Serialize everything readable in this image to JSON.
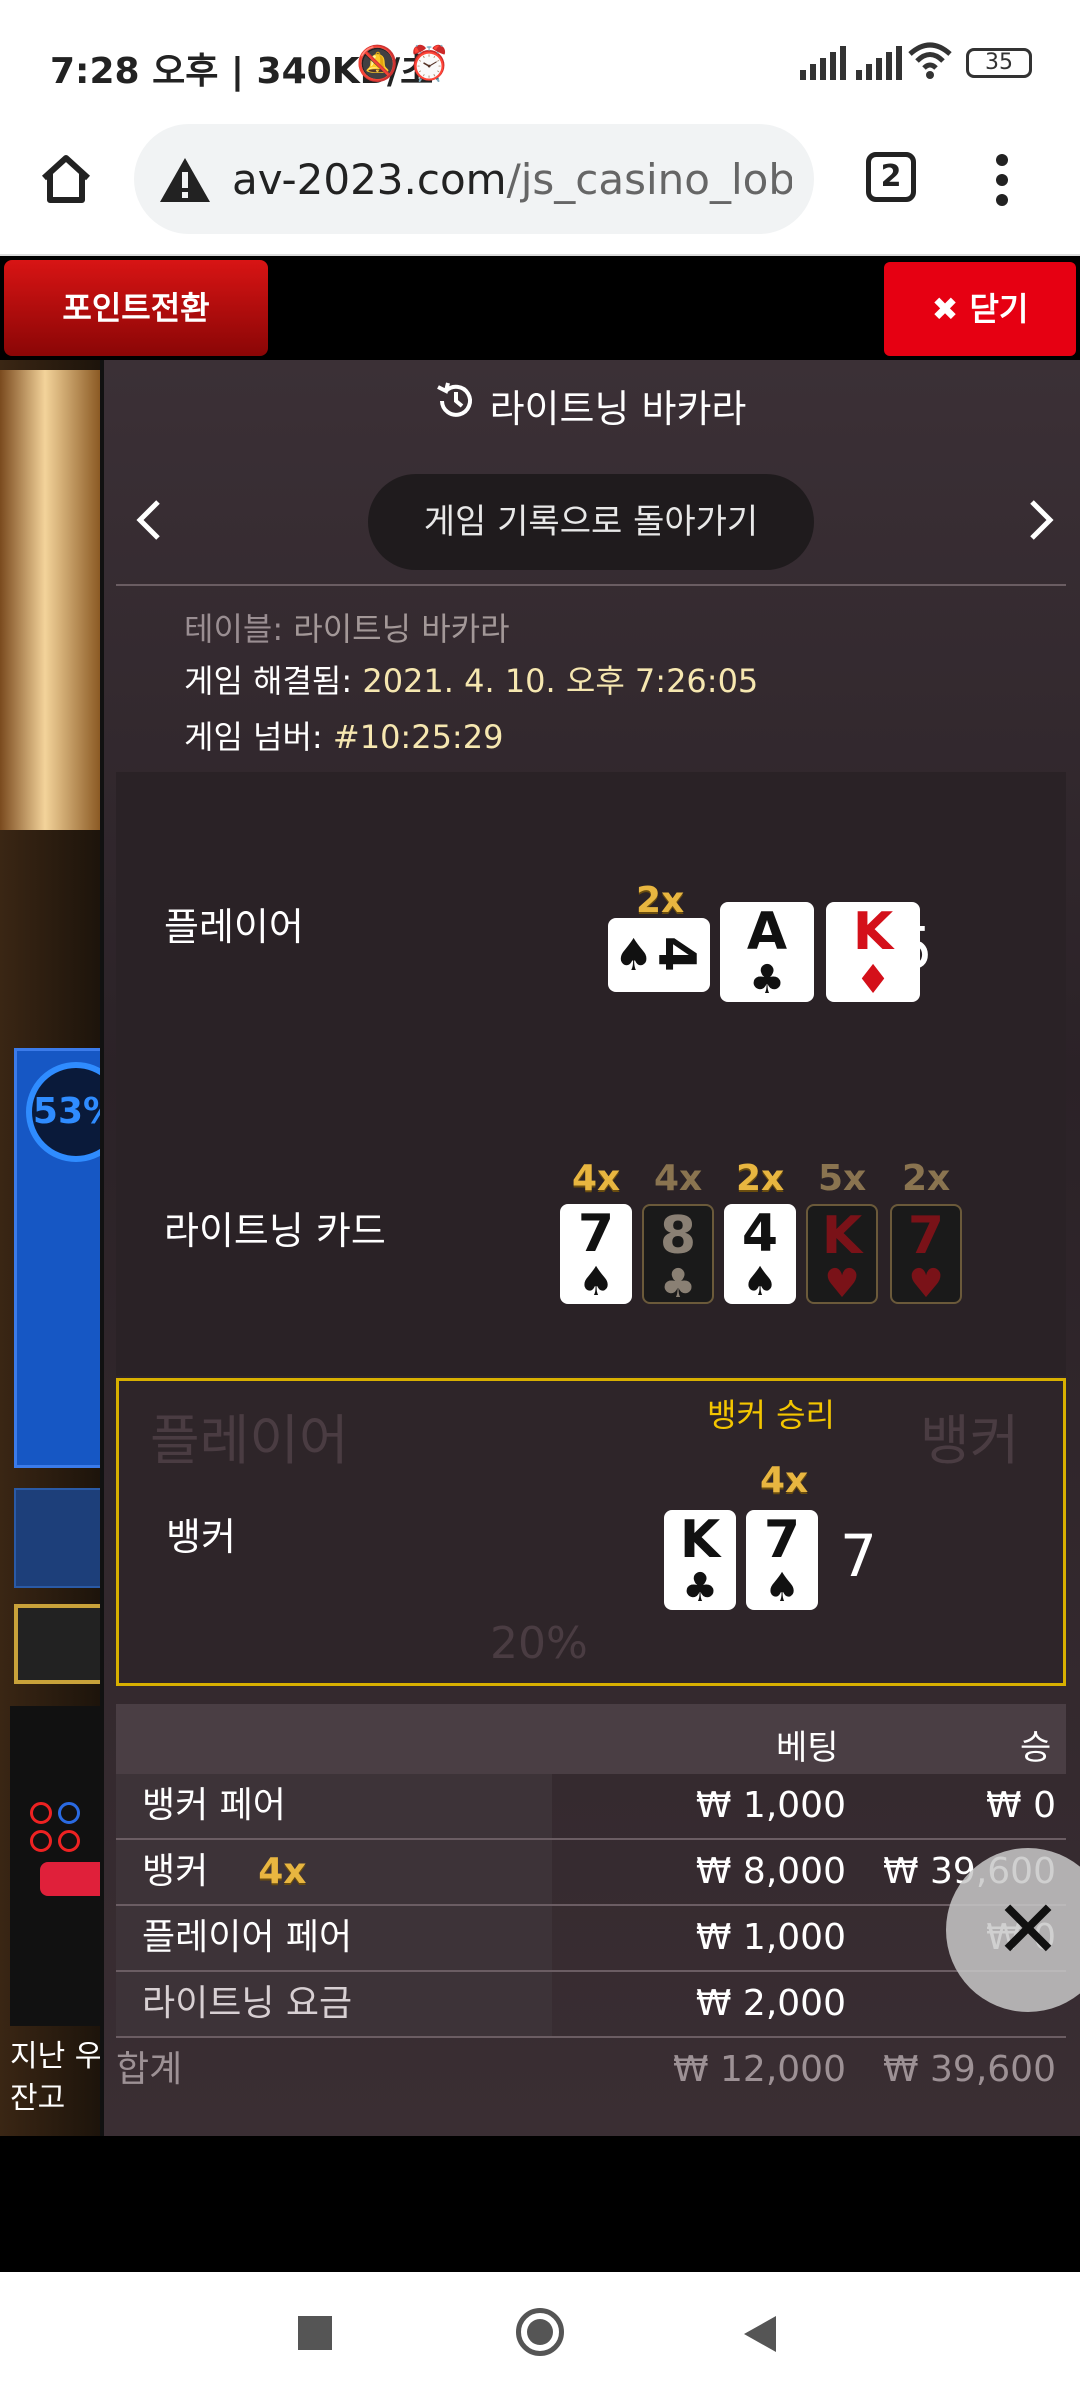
{
  "status_bar": {
    "time": "7:28 오후",
    "speed": "340KB/초",
    "battery": "35",
    "icons": [
      "mute-icon",
      "alarm-icon",
      "signal-icon",
      "signal-icon",
      "wifi-icon",
      "battery-icon"
    ]
  },
  "browser": {
    "url_domain": "av-2023.com",
    "url_path": "/js_casino_lobb",
    "tab_count": "2",
    "icons": [
      "home-icon",
      "warning-icon",
      "tabs-icon",
      "more-vert-icon"
    ]
  },
  "header": {
    "point_button": "포인트전환",
    "close_button": "✖ 닫기"
  },
  "background": {
    "percent": "53%",
    "bottom_line1": "지난 우",
    "bottom_line2": "잔고"
  },
  "modal": {
    "title": "라이트닝 바카라",
    "back_label": "게임 기록으로 돌아가기",
    "table_label": "테이블:",
    "table_value": "라이트닝 바카라",
    "resolved_label": "게임 해결됨:",
    "resolved_value": "2021. 4. 10. 오후 7:26:05",
    "number_label": "게임 넘버:",
    "number_value": "#10:25:29",
    "player": {
      "label": "플레이어",
      "multiplier": "2x",
      "cards": [
        {
          "rank": "4",
          "suit": "♠",
          "color": "black"
        },
        {
          "rank": "A",
          "suit": "♣",
          "color": "black"
        },
        {
          "rank": "K",
          "suit": "♦",
          "color": "red"
        }
      ],
      "total": "5"
    },
    "lightning": {
      "label": "라이트닝 카드",
      "cards": [
        {
          "mult": "4x",
          "rank": "7",
          "suit": "♠",
          "color": "black",
          "active": true
        },
        {
          "mult": "4x",
          "rank": "8",
          "suit": "♣",
          "color": "black",
          "active": false
        },
        {
          "mult": "2x",
          "rank": "4",
          "suit": "♠",
          "color": "black",
          "active": true
        },
        {
          "mult": "5x",
          "rank": "K",
          "suit": "♥",
          "color": "red",
          "active": false
        },
        {
          "mult": "2x",
          "rank": "7",
          "suit": "♥",
          "color": "red",
          "active": false
        }
      ]
    },
    "banker": {
      "win_label": "뱅커 승리",
      "label": "뱅커",
      "multiplier": "4x",
      "cards": [
        {
          "rank": "K",
          "suit": "♣",
          "color": "black"
        },
        {
          "rank": "7",
          "suit": "♠",
          "color": "black"
        }
      ],
      "total": "7"
    },
    "bets": {
      "header_bet": "베팅",
      "header_win": "승",
      "rows": [
        {
          "name": "뱅커 페어",
          "bet": "₩ 1,000",
          "win": "₩ 0"
        },
        {
          "name": "뱅커",
          "mult": "4x",
          "bet": "₩ 8,000",
          "win": "₩ 39,600"
        },
        {
          "name": "플레이어 페어",
          "bet": "₩ 1,000",
          "win": "₩ 0"
        },
        {
          "name": "라이트닝 요금",
          "bet": "₩ 2,000",
          "win": ""
        }
      ],
      "total_label": "합계",
      "total_bet": "₩ 12,000",
      "total_win": "₩ 39,600"
    }
  }
}
